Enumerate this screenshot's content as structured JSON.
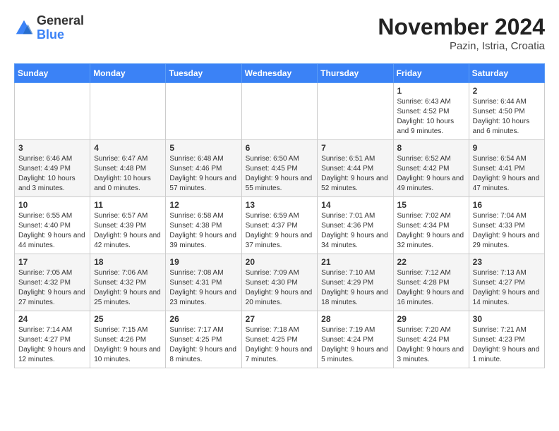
{
  "logo": {
    "general": "General",
    "blue": "Blue"
  },
  "header": {
    "month": "November 2024",
    "location": "Pazin, Istria, Croatia"
  },
  "weekdays": [
    "Sunday",
    "Monday",
    "Tuesday",
    "Wednesday",
    "Thursday",
    "Friday",
    "Saturday"
  ],
  "weeks": [
    [
      {
        "day": "",
        "info": ""
      },
      {
        "day": "",
        "info": ""
      },
      {
        "day": "",
        "info": ""
      },
      {
        "day": "",
        "info": ""
      },
      {
        "day": "",
        "info": ""
      },
      {
        "day": "1",
        "info": "Sunrise: 6:43 AM\nSunset: 4:52 PM\nDaylight: 10 hours and 9 minutes."
      },
      {
        "day": "2",
        "info": "Sunrise: 6:44 AM\nSunset: 4:50 PM\nDaylight: 10 hours and 6 minutes."
      }
    ],
    [
      {
        "day": "3",
        "info": "Sunrise: 6:46 AM\nSunset: 4:49 PM\nDaylight: 10 hours and 3 minutes."
      },
      {
        "day": "4",
        "info": "Sunrise: 6:47 AM\nSunset: 4:48 PM\nDaylight: 10 hours and 0 minutes."
      },
      {
        "day": "5",
        "info": "Sunrise: 6:48 AM\nSunset: 4:46 PM\nDaylight: 9 hours and 57 minutes."
      },
      {
        "day": "6",
        "info": "Sunrise: 6:50 AM\nSunset: 4:45 PM\nDaylight: 9 hours and 55 minutes."
      },
      {
        "day": "7",
        "info": "Sunrise: 6:51 AM\nSunset: 4:44 PM\nDaylight: 9 hours and 52 minutes."
      },
      {
        "day": "8",
        "info": "Sunrise: 6:52 AM\nSunset: 4:42 PM\nDaylight: 9 hours and 49 minutes."
      },
      {
        "day": "9",
        "info": "Sunrise: 6:54 AM\nSunset: 4:41 PM\nDaylight: 9 hours and 47 minutes."
      }
    ],
    [
      {
        "day": "10",
        "info": "Sunrise: 6:55 AM\nSunset: 4:40 PM\nDaylight: 9 hours and 44 minutes."
      },
      {
        "day": "11",
        "info": "Sunrise: 6:57 AM\nSunset: 4:39 PM\nDaylight: 9 hours and 42 minutes."
      },
      {
        "day": "12",
        "info": "Sunrise: 6:58 AM\nSunset: 4:38 PM\nDaylight: 9 hours and 39 minutes."
      },
      {
        "day": "13",
        "info": "Sunrise: 6:59 AM\nSunset: 4:37 PM\nDaylight: 9 hours and 37 minutes."
      },
      {
        "day": "14",
        "info": "Sunrise: 7:01 AM\nSunset: 4:36 PM\nDaylight: 9 hours and 34 minutes."
      },
      {
        "day": "15",
        "info": "Sunrise: 7:02 AM\nSunset: 4:34 PM\nDaylight: 9 hours and 32 minutes."
      },
      {
        "day": "16",
        "info": "Sunrise: 7:04 AM\nSunset: 4:33 PM\nDaylight: 9 hours and 29 minutes."
      }
    ],
    [
      {
        "day": "17",
        "info": "Sunrise: 7:05 AM\nSunset: 4:32 PM\nDaylight: 9 hours and 27 minutes."
      },
      {
        "day": "18",
        "info": "Sunrise: 7:06 AM\nSunset: 4:32 PM\nDaylight: 9 hours and 25 minutes."
      },
      {
        "day": "19",
        "info": "Sunrise: 7:08 AM\nSunset: 4:31 PM\nDaylight: 9 hours and 23 minutes."
      },
      {
        "day": "20",
        "info": "Sunrise: 7:09 AM\nSunset: 4:30 PM\nDaylight: 9 hours and 20 minutes."
      },
      {
        "day": "21",
        "info": "Sunrise: 7:10 AM\nSunset: 4:29 PM\nDaylight: 9 hours and 18 minutes."
      },
      {
        "day": "22",
        "info": "Sunrise: 7:12 AM\nSunset: 4:28 PM\nDaylight: 9 hours and 16 minutes."
      },
      {
        "day": "23",
        "info": "Sunrise: 7:13 AM\nSunset: 4:27 PM\nDaylight: 9 hours and 14 minutes."
      }
    ],
    [
      {
        "day": "24",
        "info": "Sunrise: 7:14 AM\nSunset: 4:27 PM\nDaylight: 9 hours and 12 minutes."
      },
      {
        "day": "25",
        "info": "Sunrise: 7:15 AM\nSunset: 4:26 PM\nDaylight: 9 hours and 10 minutes."
      },
      {
        "day": "26",
        "info": "Sunrise: 7:17 AM\nSunset: 4:25 PM\nDaylight: 9 hours and 8 minutes."
      },
      {
        "day": "27",
        "info": "Sunrise: 7:18 AM\nSunset: 4:25 PM\nDaylight: 9 hours and 7 minutes."
      },
      {
        "day": "28",
        "info": "Sunrise: 7:19 AM\nSunset: 4:24 PM\nDaylight: 9 hours and 5 minutes."
      },
      {
        "day": "29",
        "info": "Sunrise: 7:20 AM\nSunset: 4:24 PM\nDaylight: 9 hours and 3 minutes."
      },
      {
        "day": "30",
        "info": "Sunrise: 7:21 AM\nSunset: 4:23 PM\nDaylight: 9 hours and 1 minute."
      }
    ]
  ]
}
